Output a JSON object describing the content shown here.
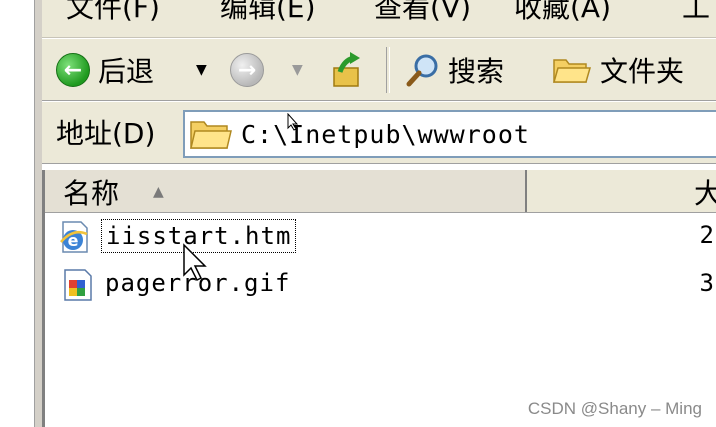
{
  "menubar": {
    "items": [
      "文件(F)",
      "编辑(E)",
      "查看(V)",
      "收藏(A)",
      "工"
    ]
  },
  "toolbar": {
    "back_label": "后退",
    "search_label": "搜索",
    "folders_label": "文件夹"
  },
  "addressbar": {
    "label": "地址(D)",
    "path": "C:\\Inetpub\\wwwroot"
  },
  "list": {
    "columns": {
      "name": "名称",
      "size": "大"
    },
    "files": [
      {
        "name": "iisstart.htm",
        "size": "2",
        "icon": "ie-html-file-icon"
      },
      {
        "name": "pagerror.gif",
        "size": "3",
        "icon": "gif-image-file-icon"
      }
    ]
  },
  "watermark": "CSDN @Shany – Ming"
}
